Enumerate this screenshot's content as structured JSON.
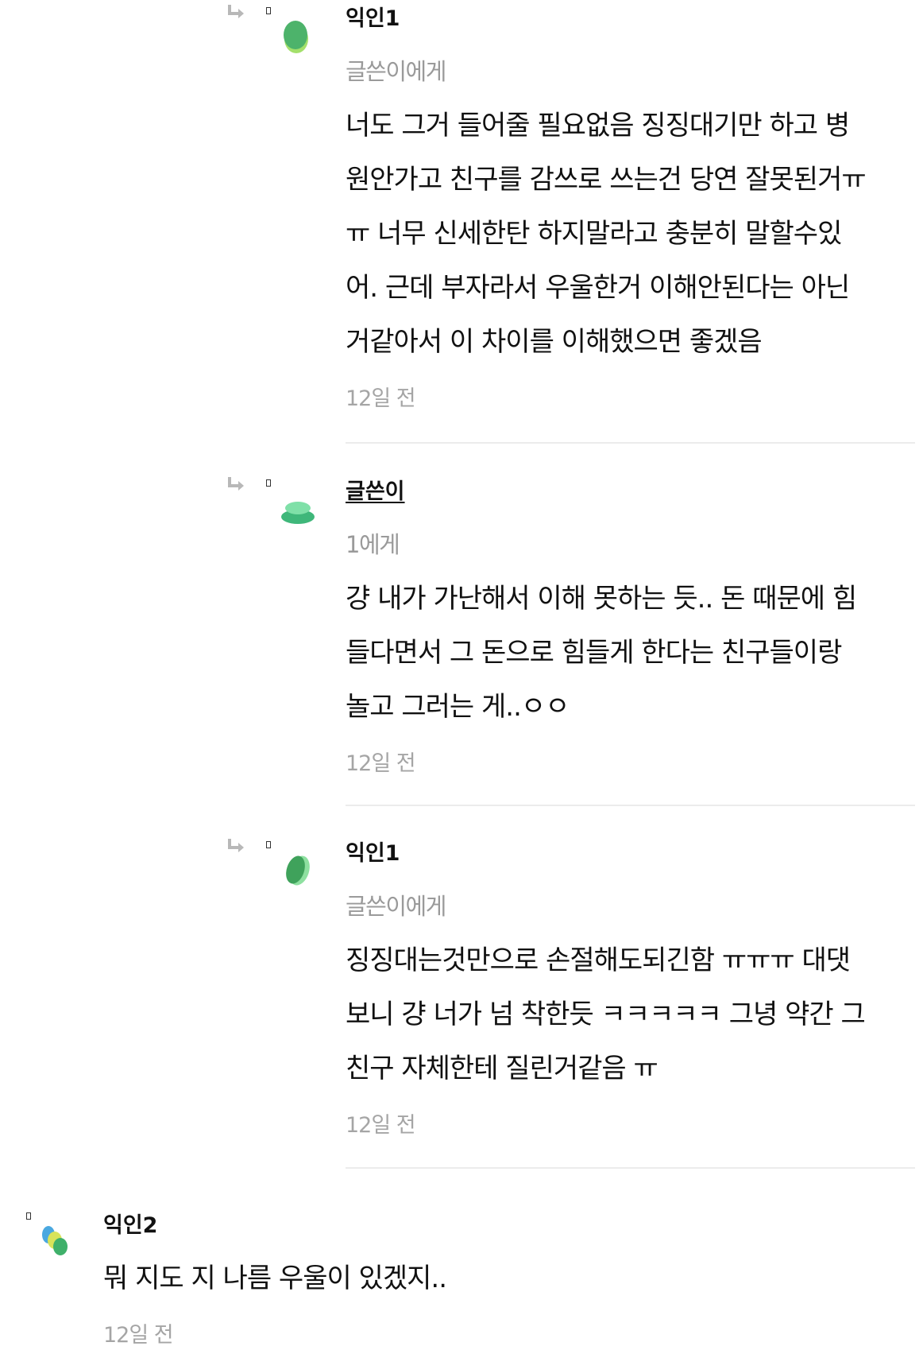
{
  "comments": [
    {
      "nickname": "익인1",
      "target": "글쓴이에게",
      "text": "너도 그거 들어줄 필요없음 징징대기만 하고 병\n원안가고 친구를 감쓰로 쓰는건 당연 잘못된거ㅠ\nㅠ 너무 신세한탄 하지말라고 충분히 말할수있\n어. 근데 부자라서 우울한거 이해안된다는 아닌\n거같아서 이 차이를 이해했으면 좋겠음",
      "time": "12일 전"
    },
    {
      "nickname": "글쓴이",
      "target": "1에게",
      "text": "걍 내가 가난해서 이해 못하는 듯.. 돈 때문에 힘\n들다면서 그 돈으로 힘들게 한다는 친구들이랑\n놀고 그러는 게..ㅇㅇ",
      "time": "12일 전"
    },
    {
      "nickname": "익인1",
      "target": "글쓴이에게",
      "text": "징징대는것만으로 손절해도되긴함 ㅠㅠㅠ 대댓\n보니 걍 너가 넘 착한듯 ㅋㅋㅋㅋㅋ 그녕 약간 그\n친구 자체한테 질린거같음 ㅠ",
      "time": "12일 전"
    },
    {
      "nickname": "익인2",
      "text": "뭐 지도 지 나름 우울이 있겠지..",
      "time": "12일 전"
    }
  ],
  "icons": {
    "reply_arrow": "reply-arrow-icon",
    "avatar_colors": [
      "#4db36b",
      "#8ed56a",
      "#5fd6a8",
      "#3fa25b",
      "#4aa8e0",
      "#d8e35a"
    ]
  }
}
